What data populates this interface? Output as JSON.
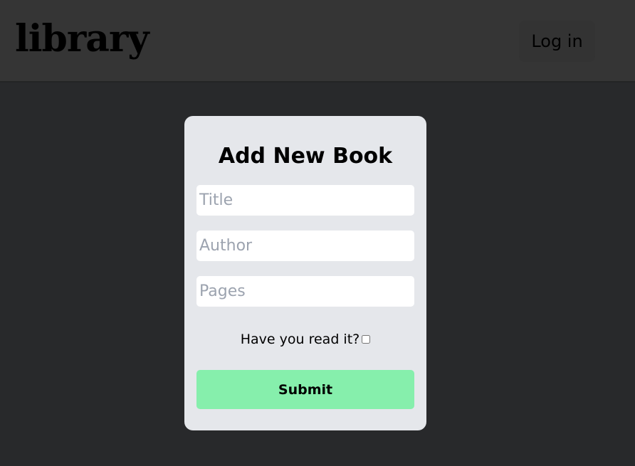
{
  "header": {
    "logo_text": "library",
    "login_label": "Log in"
  },
  "form": {
    "title": "Add New Book",
    "fields": {
      "title_placeholder": "Title",
      "author_placeholder": "Author",
      "pages_placeholder": "Pages"
    },
    "read_label": "Have you read it?",
    "read_checked": false,
    "submit_label": "Submit"
  },
  "colors": {
    "page_background": "#28292b",
    "header_background": "#353535",
    "card_background": "#e5e7eb",
    "submit_background": "#86efac"
  }
}
